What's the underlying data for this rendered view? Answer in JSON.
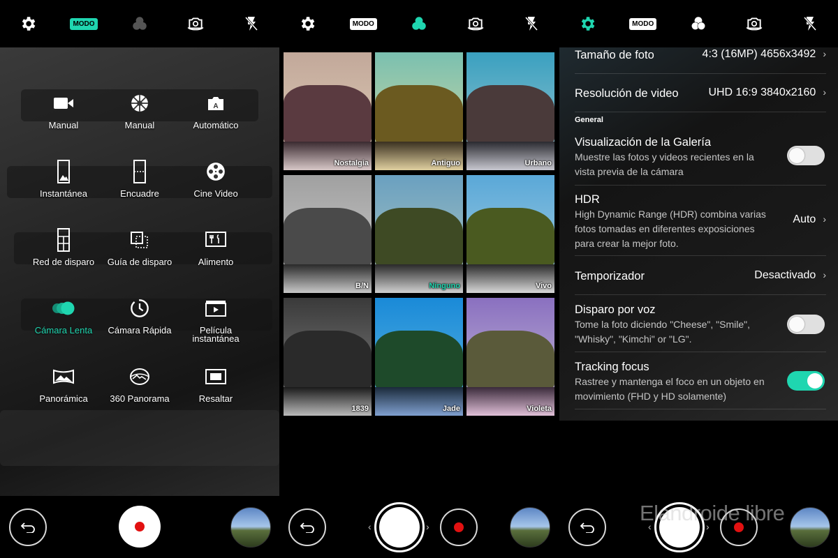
{
  "accent_color": "#1fd6b0",
  "toolbar": {
    "modo_label": "MODO",
    "icons": [
      "gear-icon",
      "modo-icon",
      "filter-icon",
      "switch-camera-icon",
      "flash-off-icon"
    ]
  },
  "modes_panel": {
    "modes": [
      {
        "label": "Manual",
        "icon": "video-camera-icon"
      },
      {
        "label": "Manual",
        "icon": "aperture-icon"
      },
      {
        "label": "Automático",
        "icon": "auto-camera-icon"
      },
      {
        "label": "Instantánea",
        "icon": "snap-icon"
      },
      {
        "label": "Encuadre",
        "icon": "frame-icon"
      },
      {
        "label": "Cine Video",
        "icon": "film-reel-icon"
      },
      {
        "label": "Red de disparo",
        "icon": "grid-shot-icon"
      },
      {
        "label": "Guía de disparo",
        "icon": "guide-shot-icon"
      },
      {
        "label": "Alimento",
        "icon": "food-icon"
      },
      {
        "label": "Cámara Lenta",
        "icon": "slow-motion-icon",
        "active": true
      },
      {
        "label": "Cámara Rápida",
        "icon": "timelapse-icon"
      },
      {
        "label": "Película instantánea",
        "icon": "snap-movie-icon"
      },
      {
        "label": "Panorámica",
        "icon": "panorama-icon"
      },
      {
        "label": "360 Panorama",
        "icon": "panorama-360-icon"
      },
      {
        "label": "Resaltar",
        "icon": "highlight-icon"
      }
    ]
  },
  "filters_panel": {
    "selected": "Ninguno",
    "filters": [
      "Nostalgia",
      "Antiguo",
      "Urbano",
      "B/N",
      "Ninguno",
      "Vivo",
      "1839",
      "Jade",
      "Violeta"
    ]
  },
  "settings_panel": {
    "section_general": "General",
    "photo_size": {
      "title": "Tamaño de foto",
      "value": "4:3 (16MP) 4656x3492"
    },
    "video_resolution": {
      "title": "Resolución de video",
      "value": "UHD 16:9 3840x2160"
    },
    "gallery_view": {
      "title": "Visualización de la Galería",
      "desc": "Muestre las fotos y videos recientes en la vista previa de la cámara",
      "enabled": false
    },
    "hdr": {
      "title": "HDR",
      "desc": "High Dynamic Range (HDR) combina varias fotos tomadas en diferentes exposiciones para crear la mejor foto.",
      "value": "Auto"
    },
    "timer": {
      "title": "Temporizador",
      "value": "Desactivado"
    },
    "voice_shot": {
      "title": "Disparo por voz",
      "desc": "Tome la foto diciendo \"Cheese\", \"Smile\", \"Whisky\", \"Kimchi\" or \"LG\".",
      "enabled": false
    },
    "tracking_focus": {
      "title": "Tracking focus",
      "desc": "Rastree y mantenga el foco en un objeto en movimiento (FHD y HD solamente)",
      "enabled": true
    }
  },
  "watermark": "Elandroide libre"
}
